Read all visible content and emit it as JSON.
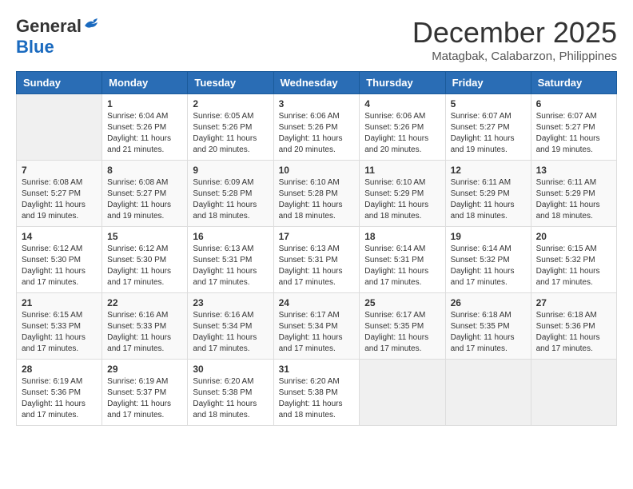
{
  "header": {
    "logo_general": "General",
    "logo_blue": "Blue",
    "month_title": "December 2025",
    "location": "Matagbak, Calabarzon, Philippines"
  },
  "days_of_week": [
    "Sunday",
    "Monday",
    "Tuesday",
    "Wednesday",
    "Thursday",
    "Friday",
    "Saturday"
  ],
  "weeks": [
    [
      {
        "day": "",
        "info": ""
      },
      {
        "day": "1",
        "info": "Sunrise: 6:04 AM\nSunset: 5:26 PM\nDaylight: 11 hours\nand 21 minutes."
      },
      {
        "day": "2",
        "info": "Sunrise: 6:05 AM\nSunset: 5:26 PM\nDaylight: 11 hours\nand 20 minutes."
      },
      {
        "day": "3",
        "info": "Sunrise: 6:06 AM\nSunset: 5:26 PM\nDaylight: 11 hours\nand 20 minutes."
      },
      {
        "day": "4",
        "info": "Sunrise: 6:06 AM\nSunset: 5:26 PM\nDaylight: 11 hours\nand 20 minutes."
      },
      {
        "day": "5",
        "info": "Sunrise: 6:07 AM\nSunset: 5:27 PM\nDaylight: 11 hours\nand 19 minutes."
      },
      {
        "day": "6",
        "info": "Sunrise: 6:07 AM\nSunset: 5:27 PM\nDaylight: 11 hours\nand 19 minutes."
      }
    ],
    [
      {
        "day": "7",
        "info": "Sunrise: 6:08 AM\nSunset: 5:27 PM\nDaylight: 11 hours\nand 19 minutes."
      },
      {
        "day": "8",
        "info": "Sunrise: 6:08 AM\nSunset: 5:27 PM\nDaylight: 11 hours\nand 19 minutes."
      },
      {
        "day": "9",
        "info": "Sunrise: 6:09 AM\nSunset: 5:28 PM\nDaylight: 11 hours\nand 18 minutes."
      },
      {
        "day": "10",
        "info": "Sunrise: 6:10 AM\nSunset: 5:28 PM\nDaylight: 11 hours\nand 18 minutes."
      },
      {
        "day": "11",
        "info": "Sunrise: 6:10 AM\nSunset: 5:29 PM\nDaylight: 11 hours\nand 18 minutes."
      },
      {
        "day": "12",
        "info": "Sunrise: 6:11 AM\nSunset: 5:29 PM\nDaylight: 11 hours\nand 18 minutes."
      },
      {
        "day": "13",
        "info": "Sunrise: 6:11 AM\nSunset: 5:29 PM\nDaylight: 11 hours\nand 18 minutes."
      }
    ],
    [
      {
        "day": "14",
        "info": "Sunrise: 6:12 AM\nSunset: 5:30 PM\nDaylight: 11 hours\nand 17 minutes."
      },
      {
        "day": "15",
        "info": "Sunrise: 6:12 AM\nSunset: 5:30 PM\nDaylight: 11 hours\nand 17 minutes."
      },
      {
        "day": "16",
        "info": "Sunrise: 6:13 AM\nSunset: 5:31 PM\nDaylight: 11 hours\nand 17 minutes."
      },
      {
        "day": "17",
        "info": "Sunrise: 6:13 AM\nSunset: 5:31 PM\nDaylight: 11 hours\nand 17 minutes."
      },
      {
        "day": "18",
        "info": "Sunrise: 6:14 AM\nSunset: 5:31 PM\nDaylight: 11 hours\nand 17 minutes."
      },
      {
        "day": "19",
        "info": "Sunrise: 6:14 AM\nSunset: 5:32 PM\nDaylight: 11 hours\nand 17 minutes."
      },
      {
        "day": "20",
        "info": "Sunrise: 6:15 AM\nSunset: 5:32 PM\nDaylight: 11 hours\nand 17 minutes."
      }
    ],
    [
      {
        "day": "21",
        "info": "Sunrise: 6:15 AM\nSunset: 5:33 PM\nDaylight: 11 hours\nand 17 minutes."
      },
      {
        "day": "22",
        "info": "Sunrise: 6:16 AM\nSunset: 5:33 PM\nDaylight: 11 hours\nand 17 minutes."
      },
      {
        "day": "23",
        "info": "Sunrise: 6:16 AM\nSunset: 5:34 PM\nDaylight: 11 hours\nand 17 minutes."
      },
      {
        "day": "24",
        "info": "Sunrise: 6:17 AM\nSunset: 5:34 PM\nDaylight: 11 hours\nand 17 minutes."
      },
      {
        "day": "25",
        "info": "Sunrise: 6:17 AM\nSunset: 5:35 PM\nDaylight: 11 hours\nand 17 minutes."
      },
      {
        "day": "26",
        "info": "Sunrise: 6:18 AM\nSunset: 5:35 PM\nDaylight: 11 hours\nand 17 minutes."
      },
      {
        "day": "27",
        "info": "Sunrise: 6:18 AM\nSunset: 5:36 PM\nDaylight: 11 hours\nand 17 minutes."
      }
    ],
    [
      {
        "day": "28",
        "info": "Sunrise: 6:19 AM\nSunset: 5:36 PM\nDaylight: 11 hours\nand 17 minutes."
      },
      {
        "day": "29",
        "info": "Sunrise: 6:19 AM\nSunset: 5:37 PM\nDaylight: 11 hours\nand 17 minutes."
      },
      {
        "day": "30",
        "info": "Sunrise: 6:20 AM\nSunset: 5:38 PM\nDaylight: 11 hours\nand 18 minutes."
      },
      {
        "day": "31",
        "info": "Sunrise: 6:20 AM\nSunset: 5:38 PM\nDaylight: 11 hours\nand 18 minutes."
      },
      {
        "day": "",
        "info": ""
      },
      {
        "day": "",
        "info": ""
      },
      {
        "day": "",
        "info": ""
      }
    ]
  ]
}
